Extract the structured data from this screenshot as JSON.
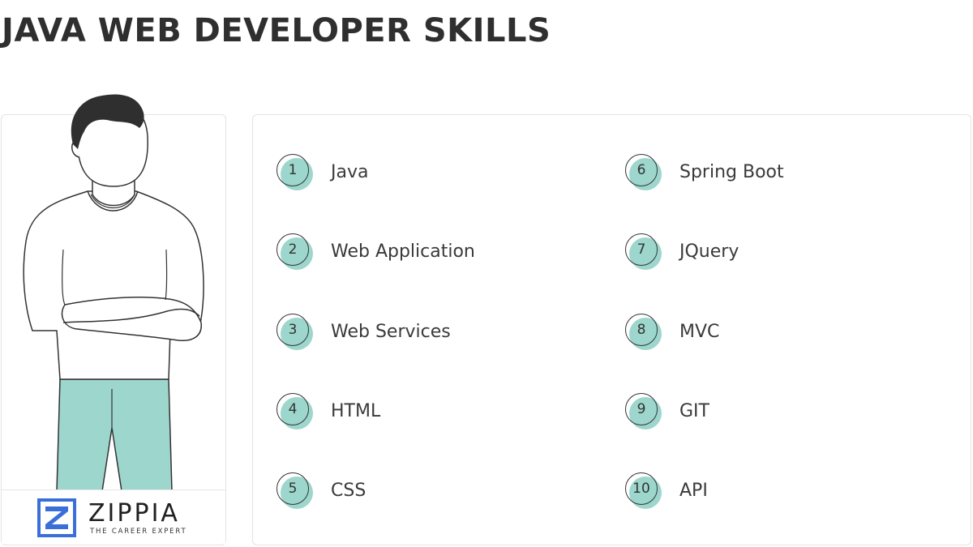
{
  "page": {
    "title": "JAVA WEB DEVELOPER SKILLS"
  },
  "logo": {
    "wordmark": "ZIPPIA",
    "tagline": "THE CAREER EXPERT",
    "brand_color": "#3b6fd8"
  },
  "colors": {
    "accent": "#9dd6cc",
    "text": "#333333",
    "border": "#e3e3e3"
  },
  "illustration": {
    "icon": "person-arms-crossed-illustration"
  },
  "skills": [
    {
      "number": "1",
      "label": "Java"
    },
    {
      "number": "2",
      "label": "Web Application"
    },
    {
      "number": "3",
      "label": "Web Services"
    },
    {
      "number": "4",
      "label": "HTML"
    },
    {
      "number": "5",
      "label": "CSS"
    },
    {
      "number": "6",
      "label": "Spring Boot"
    },
    {
      "number": "7",
      "label": "JQuery"
    },
    {
      "number": "8",
      "label": "MVC"
    },
    {
      "number": "9",
      "label": "GIT"
    },
    {
      "number": "10",
      "label": "API"
    }
  ]
}
